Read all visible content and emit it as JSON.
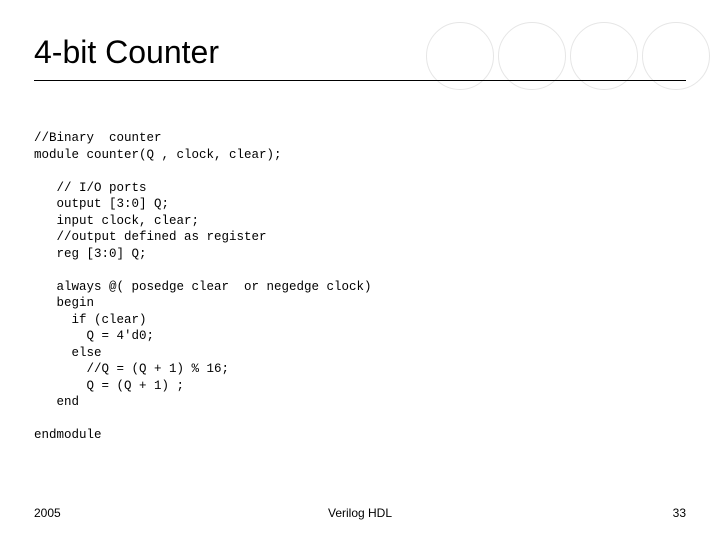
{
  "title": "4-bit Counter",
  "code": "//Binary  counter\nmodule counter(Q , clock, clear);\n\n   // I/O ports\n   output [3:0] Q;\n   input clock, clear;\n   //output defined as register\n   reg [3:0] Q;\n\n   always @( posedge clear  or negedge clock)\n   begin\n     if (clear)\n       Q = 4'd0;\n     else\n       //Q = (Q + 1) % 16;\n       Q = (Q + 1) ;\n   end\n\nendmodule",
  "footer": {
    "left": "2005",
    "center": "Verilog HDL",
    "right": "33"
  }
}
